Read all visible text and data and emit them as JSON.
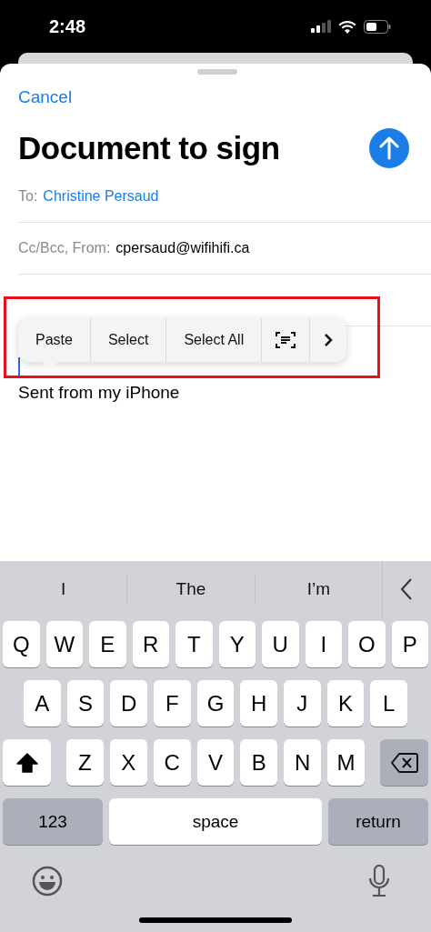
{
  "status_bar": {
    "time": "2:48"
  },
  "compose": {
    "cancel": "Cancel",
    "title": "Document to sign",
    "fields": [
      {
        "label": "To:",
        "value": "Christine Persaud",
        "kind": "recipient"
      },
      {
        "label": "Cc/Bcc, From:",
        "value": "cpersaud@wifihifi.ca",
        "kind": "address"
      }
    ]
  },
  "context_menu": {
    "items": [
      {
        "kind": "text",
        "label": "Paste"
      },
      {
        "kind": "text",
        "label": "Select"
      },
      {
        "kind": "text",
        "label": "Select All"
      },
      {
        "kind": "scan"
      },
      {
        "kind": "more"
      }
    ]
  },
  "body": {
    "signature": "Sent from my iPhone"
  },
  "keyboard": {
    "suggestions": [
      "I",
      "The",
      "I’m"
    ],
    "rows": [
      [
        "Q",
        "W",
        "E",
        "R",
        "T",
        "Y",
        "U",
        "I",
        "O",
        "P"
      ],
      [
        "A",
        "S",
        "D",
        "F",
        "G",
        "H",
        "J",
        "K",
        "L"
      ],
      [
        "Z",
        "X",
        "C",
        "V",
        "B",
        "N",
        "M"
      ]
    ],
    "shift_on": true,
    "bottom": {
      "numbers": "123",
      "space": "space",
      "return": "return"
    }
  }
}
